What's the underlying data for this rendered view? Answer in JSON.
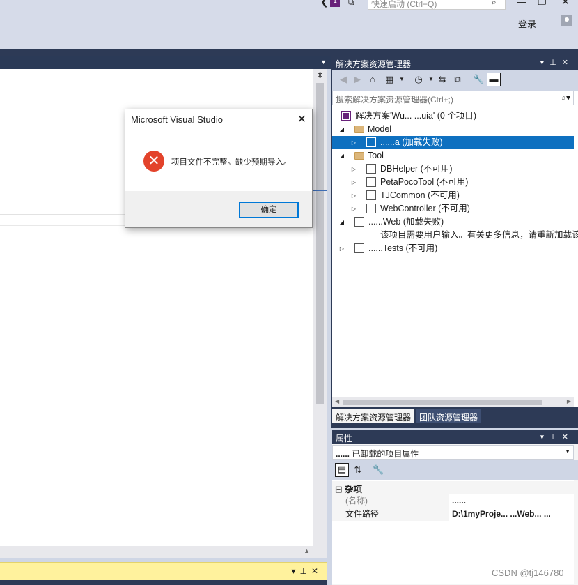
{
  "titlebar": {
    "quick_launch_placeholder": "快速启动 (Ctrl+Q)",
    "login_label": "登录",
    "notification_count": "1"
  },
  "dialog": {
    "title": "Microsoft Visual Studio",
    "message": "项目文件不完整。缺少预期导入。",
    "ok_label": "确定",
    "close_glyph": "✕"
  },
  "solution_explorer": {
    "title": "解决方案资源管理器",
    "search_placeholder": "搜索解决方案资源管理器(Ctrl+;)",
    "solution_label": "解决方案'Wu... ...uia' (0 个项目)",
    "folder_model": "Model",
    "model_project": "......a (加载失败)",
    "folder_tool": "Tool",
    "tool_items": [
      "DBHelper (不可用)",
      "PetaPocoTool (不可用)",
      "TJCommon (不可用)",
      "WebController (不可用)"
    ],
    "web_project": "......Web (加载失败)",
    "web_project_note": "该项目需要用户输入。有关更多信息，请重新加载该",
    "tests_project": "......Tests (不可用)",
    "tabs": [
      "解决方案资源管理器",
      "团队资源管理器"
    ]
  },
  "properties": {
    "title": "属性",
    "object_name": "......",
    "object_desc": "已卸载的项目属性",
    "category": "杂项",
    "rows": [
      {
        "name": "(名称)",
        "value": "......"
      },
      {
        "name": "文件路径",
        "value": "D:\\1myProje... ...Web... ..."
      }
    ]
  },
  "watermark": "CSDN @tj146780",
  "colors": {
    "accent": "#0e70c0",
    "panel_dark": "#2d3a56",
    "error": "#e3432b",
    "bottom_bar": "#fff29d"
  }
}
